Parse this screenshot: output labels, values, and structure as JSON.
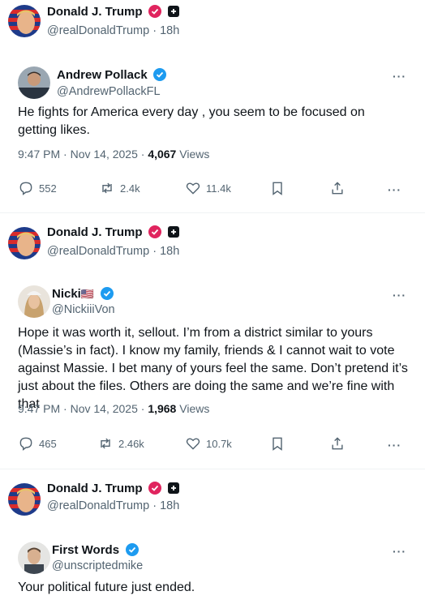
{
  "trump": {
    "name": "Donald J. Trump",
    "handle": "@realDonaldTrump",
    "age": "18h"
  },
  "replies": [
    {
      "name": "Andrew Pollack",
      "handle": "@AndrewPollackFL",
      "text": "He fights for America every day , you seem to be focused on getting likes.",
      "time": "9:47 PM · Nov 14, 2025 · ",
      "views": "4,067",
      "views_label": " Views",
      "stats": {
        "replies": "552",
        "reposts": "2.4k",
        "likes": "11.4k"
      }
    },
    {
      "name": "Nicki",
      "flag": "🇺🇸",
      "handle": "@NickiiiVon",
      "text": "Hope it was worth it, sellout. I’m from a district similar to yours (Massie’s in fact). I know my family, friends & I cannot wait to vote against Massie. I bet many of yours feel the same. Don’t pretend it’s just about the files. Others are doing the same and we’re fine with that",
      "time": "9:47 PM · Nov 14, 2025 · ",
      "views": "1,968",
      "views_label": " Views",
      "stats": {
        "replies": "465",
        "reposts": "2.46k",
        "likes": "10.7k"
      }
    },
    {
      "name": "First Words",
      "handle": "@unscriptedmike",
      "text": "Your political future just ended."
    }
  ],
  "more_label": "···",
  "colors": {
    "verified_blue": "#1d9bf0",
    "verified_pink": "#e0245e",
    "text": "#0f1419",
    "muted": "#536471"
  }
}
